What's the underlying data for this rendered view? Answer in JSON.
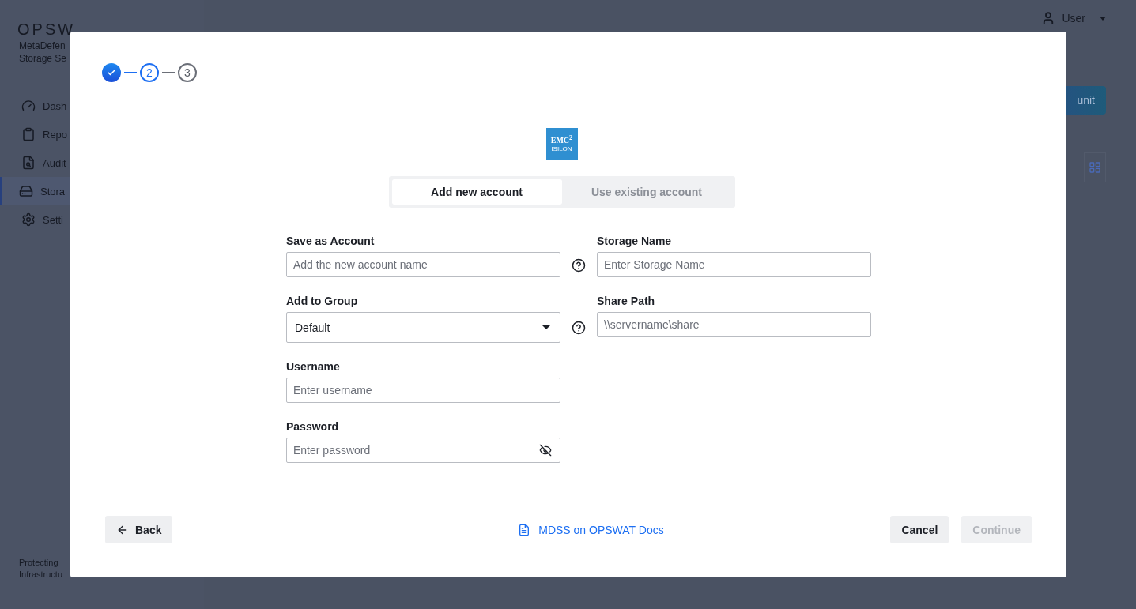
{
  "background": {
    "brand": "OPSW",
    "product_lines": [
      "MetaDefen",
      "Storage Se"
    ],
    "nav": [
      {
        "label": "Dash",
        "selected": false
      },
      {
        "label": "Repo",
        "selected": false
      },
      {
        "label": "Audit",
        "selected": false
      },
      {
        "label": "Stora",
        "selected": true
      },
      {
        "label": "Setti",
        "selected": false
      }
    ],
    "footer_lines": [
      "Protecting",
      "Infrastructu"
    ],
    "user": "User",
    "primary_button": "unit"
  },
  "dialog": {
    "steps": [
      {
        "done": true,
        "current": false
      },
      {
        "label": "2",
        "done": false,
        "current": true
      },
      {
        "label": "3",
        "done": false,
        "current": false
      }
    ],
    "logo": {
      "top": "EMC$^{2}$",
      "bottom": "ISILON"
    },
    "tabs": [
      {
        "label": "Add new account",
        "selected": true
      },
      {
        "label": "Use existing account",
        "selected": false
      }
    ],
    "left_fields": [
      {
        "kind": "text",
        "label": "Save as Account",
        "placeholder": "Add the new account name",
        "help": true
      },
      {
        "kind": "select",
        "label": "Add to Group",
        "value": "Default",
        "help": true
      },
      {
        "kind": "text",
        "label": "Username",
        "placeholder": "Enter username"
      },
      {
        "kind": "password",
        "label": "Password",
        "placeholder": "Enter password"
      }
    ],
    "right_fields": [
      {
        "kind": "text",
        "label": "Storage Name",
        "placeholder": "Enter Storage Name"
      },
      {
        "kind": "text",
        "label": "Share Path",
        "placeholder": "\\\\servername\\share"
      }
    ],
    "back": "Back",
    "docs_link": "MDSS on OPSWAT Docs",
    "cancel": "Cancel",
    "continue": {
      "label": "Continue",
      "disabled": true
    }
  }
}
